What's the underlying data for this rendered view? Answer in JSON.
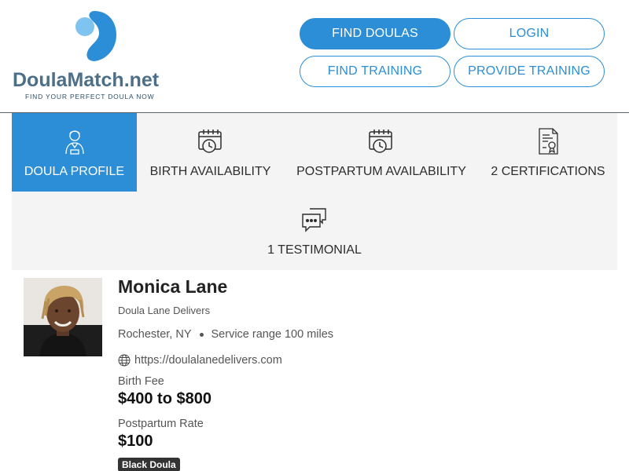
{
  "logo": {
    "name_main": "DoulaMatch",
    "name_suffix": ".net",
    "tagline": "FIND YOUR PERFECT DOULA NOW"
  },
  "nav": {
    "find_doulas": "FIND DOULAS",
    "login": "LOGIN",
    "find_training": "FIND TRAINING",
    "provide_training": "PROVIDE TRAINING"
  },
  "tabs": [
    {
      "label": "DOULA PROFILE",
      "icon": "doula-person-icon",
      "active": true
    },
    {
      "label": "BIRTH AVAILABILITY",
      "icon": "calendar-clock-icon",
      "active": false
    },
    {
      "label": "POSTPARTUM AVAILABILITY",
      "icon": "calendar-clock-icon",
      "active": false
    },
    {
      "label": "2 CERTIFICATIONS",
      "icon": "certificate-icon",
      "active": false
    },
    {
      "label": "1 TESTIMONIAL",
      "icon": "chat-bubbles-icon",
      "active": false
    }
  ],
  "profile": {
    "name": "Monica Lane",
    "business": "Doula Lane Delivers",
    "location": "Rochester, NY",
    "service_range": "Service range 100 miles",
    "website": "https://doulalanedelivers.com",
    "birth_fee_label": "Birth Fee",
    "birth_fee": "$400 to $800",
    "postpartum_label": "Postpartum Rate",
    "postpartum_rate": "$100",
    "badge": "Black Doula"
  },
  "colors": {
    "accent": "#2b8ed6",
    "logo_text": "#4d6f88",
    "tab_bg": "#f4f4f4"
  }
}
